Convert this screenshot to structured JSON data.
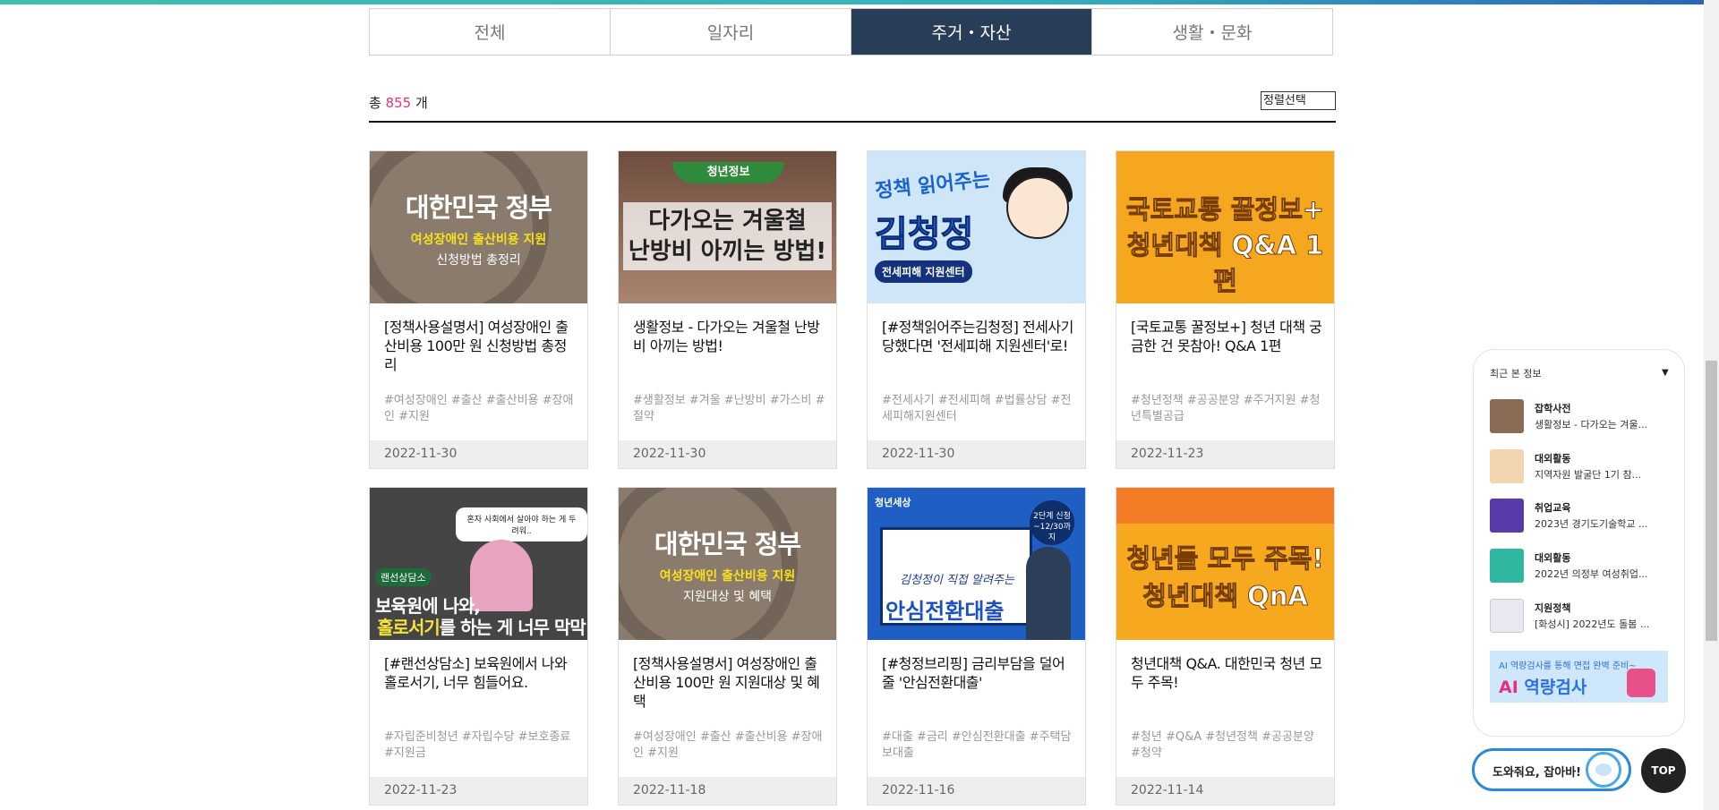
{
  "tabs": [
    {
      "label": "전체",
      "active": false
    },
    {
      "label": "일자리",
      "active": false
    },
    {
      "label": "주거・자산",
      "active": true
    },
    {
      "label": "생활・문화",
      "active": false
    }
  ],
  "summary": {
    "prefix": "총",
    "count": "855",
    "suffix": "개"
  },
  "sort": {
    "label": "정렬선택"
  },
  "cards": [
    {
      "title": "[정책사용설명서] 여성장애인 출산비용 100만 원 신청방법 총정리",
      "tags": "#여성장애인 #출산 #출산비용 #장애인 #지원",
      "date": "2022-11-30",
      "thumb": {
        "big": "대한민국 정부",
        "yellow": "여성장애인 출산비용 지원",
        "sub": "신청방법 총정리"
      }
    },
    {
      "title": "생활정보 - 다가오는 겨울철 난방비 아끼는 방법!",
      "tags": "#생활정보 #겨울 #난방비 #가스비 #절약",
      "date": "2022-11-30",
      "thumb": {
        "banner": "청년정보",
        "line1": "다가오는 겨울철",
        "line2": "난방비 아끼는 방법!"
      }
    },
    {
      "title": "[#정책읽어주는김청정] 전세사기 당했다면 '전세피해 지원센터'로!",
      "tags": "#전세사기 #전세피해 #법률상담 #전세피해지원센터",
      "date": "2022-11-30",
      "thumb": {
        "line1": "정책 읽어주는",
        "line2": "김청정",
        "line3": "전세피해 지원센터"
      }
    },
    {
      "title": "[국토교통 꿀정보+] 청년 대책 궁금한 건 못참아! Q&A 1편",
      "tags": "#청년정책 #공공분양 #주거지원 #청년특별공급",
      "date": "2022-11-23",
      "thumb": {
        "line1": "국토교통 꿀정보+",
        "line2": "청년대책 Q&A 1편"
      }
    },
    {
      "title": "[#랜선상담소] 보육원에서 나와 홀로서기, 너무 힘들어요.",
      "tags": "#자립준비청년 #자립수당 #보호종료 #지원금",
      "date": "2022-11-23",
      "thumb": {
        "bubble": "혼자 사회에서 살아야 하는 게 두려워..",
        "tag": "랜선상담소",
        "line1": "보육원에 나와,",
        "line2a": "홀로서기",
        "line2b": "를 하는 게 너무 막막해요."
      }
    },
    {
      "title": "[정책사용설명서] 여성장애인 출산비용 100만 원 지원대상 및 혜택",
      "tags": "#여성장애인 #출산 #출산비용 #장애인 #지원",
      "date": "2022-11-18",
      "thumb": {
        "big": "대한민국 정부",
        "yellow": "여성장애인 출산비용 지원",
        "sub": "지원대상 및 혜택"
      }
    },
    {
      "title": "[#청정브리핑] 금리부담을 덜어줄 '안심전환대출'",
      "tags": "#대출 #금리 #안심전환대출 #주택담보대출",
      "date": "2022-11-16",
      "thumb": {
        "brand": "청년세상",
        "hand": "김청정이 직접 알려주는",
        "big": "안심전환대출",
        "badge": "2단계 신청 ~12/30까지"
      }
    },
    {
      "title": "청년대책 Q&A. 대한민국 청년 모두 주목!",
      "tags": "#청년 #Q&A #청년정책 #공공분양 #청약",
      "date": "2022-11-14",
      "thumb": {
        "line1": "청년들 모두 주목!",
        "line2": "청년대책 QnA"
      }
    }
  ],
  "recent": {
    "title": "최근 본 정보",
    "items": [
      {
        "category": "잡학사전",
        "text": "생활정보 - 다가오는 겨울...",
        "color": "#8a6b55"
      },
      {
        "category": "대외활동",
        "text": "지역자원 발굴단 1기 참...",
        "color": "#f3d5b0"
      },
      {
        "category": "취업교육",
        "text": "2023년 경기도기술학교 ...",
        "color": "#5a3aa8"
      },
      {
        "category": "대외활동",
        "text": "2022년 의정부 여성취업...",
        "color": "#2fb7a0"
      },
      {
        "category": "지원정책",
        "text": "[화성시] 2022년도 돌봄 ...",
        "color": "#e9e9f2"
      }
    ],
    "banner": {
      "small": "AI 역량검사를 통해 면접 완벽 준비~",
      "ai": "AI",
      "big": " 역량검사"
    }
  },
  "help": {
    "label": "도와줘요, 잡아바!"
  },
  "top_button": {
    "label": "TOP"
  }
}
